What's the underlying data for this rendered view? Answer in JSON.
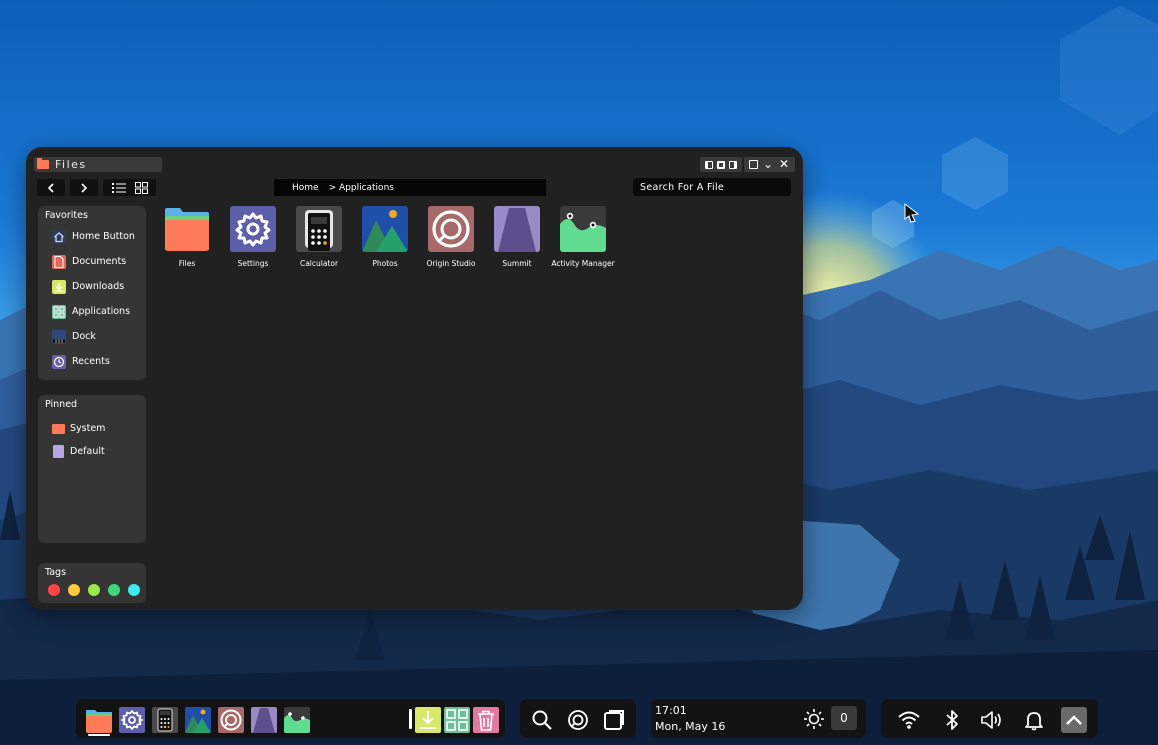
{
  "window": {
    "title": "Files",
    "breadcrumb": {
      "home": "Home",
      "current": "> Applications"
    },
    "search_placeholder": "Search For A File"
  },
  "sidebar": {
    "favorites_title": "Favorites",
    "favorites": [
      {
        "label": "Home Button",
        "icon": "home-icon"
      },
      {
        "label": "Documents",
        "icon": "documents-icon"
      },
      {
        "label": "Downloads",
        "icon": "downloads-icon"
      },
      {
        "label": "Applications",
        "icon": "applications-icon"
      },
      {
        "label": "Dock",
        "icon": "dock-icon"
      },
      {
        "label": "Recents",
        "icon": "recents-icon"
      }
    ],
    "pinned_title": "Pinned",
    "pinned": [
      {
        "label": "System",
        "icon": "folder-icon"
      },
      {
        "label": "Default",
        "icon": "file-icon"
      }
    ],
    "tags_title": "Tags",
    "tags": [
      "#ff4444",
      "#ffc93c",
      "#9be84a",
      "#3ed87a",
      "#3fe8f0"
    ]
  },
  "apps": [
    {
      "label": "Files",
      "icon": "files-app-icon"
    },
    {
      "label": "Settings",
      "icon": "settings-app-icon"
    },
    {
      "label": "Calculator",
      "icon": "calculator-app-icon"
    },
    {
      "label": "Photos",
      "icon": "photos-app-icon"
    },
    {
      "label": "Origin Studio",
      "icon": "origin-studio-app-icon"
    },
    {
      "label": "Summit",
      "icon": "summit-app-icon"
    },
    {
      "label": "Activity Manager",
      "icon": "activity-manager-app-icon"
    }
  ],
  "taskbar": {
    "time": "17:01",
    "date": "Mon, May 16",
    "brightness_value": "0"
  },
  "colors": {
    "window_bg": "#212121",
    "panel_bg": "#353535",
    "folder": "#ff7a59",
    "settings": "#5d5fa8",
    "summit": "#7b6aa8",
    "activity": "#4fd88a",
    "download": "#d8e86a",
    "apps_grid": "#6fbf9a",
    "trash": "#e27aa0"
  }
}
